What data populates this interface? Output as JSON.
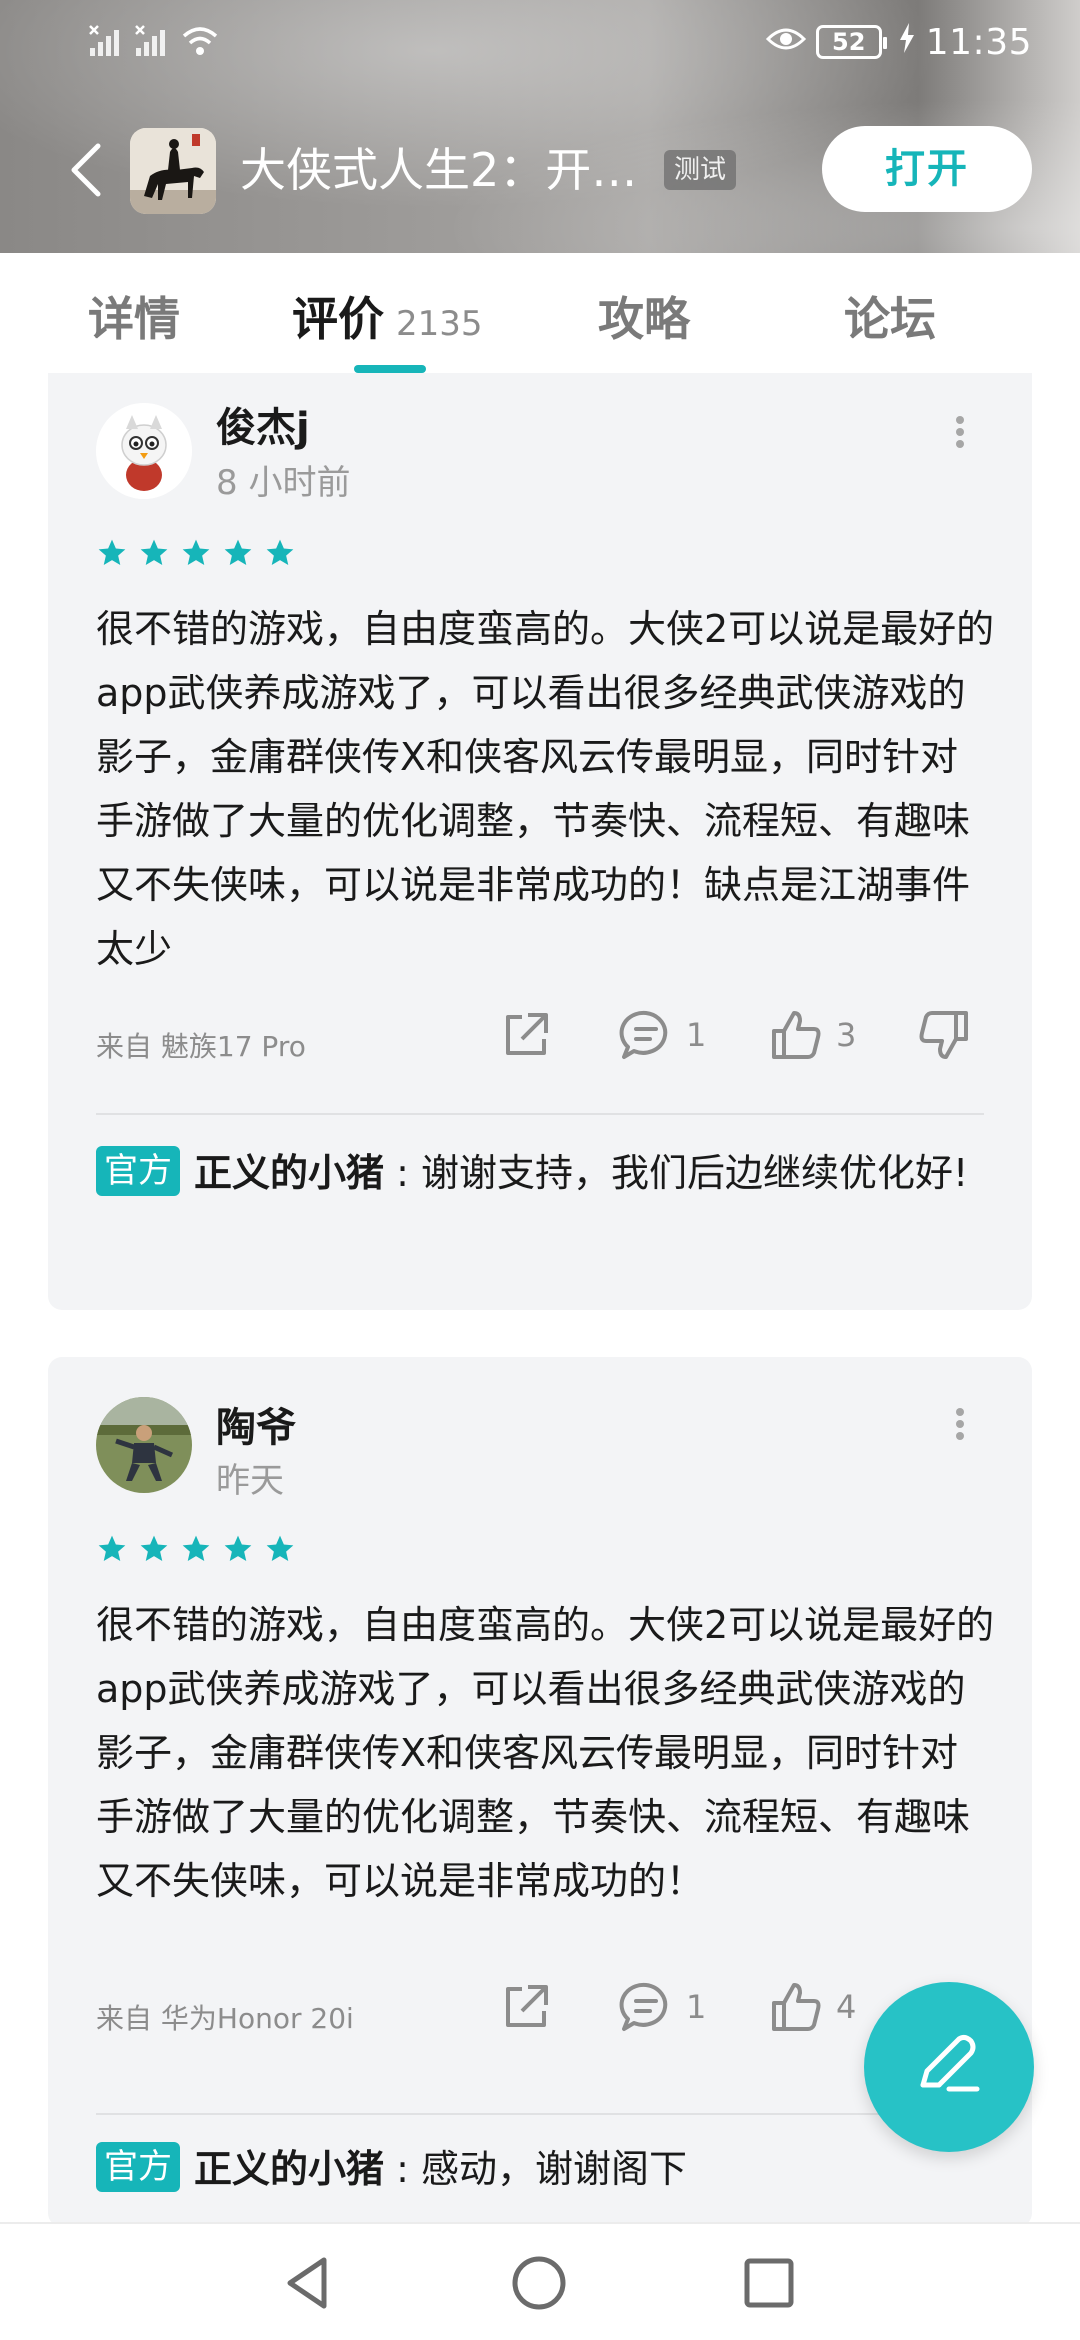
{
  "status_bar": {
    "battery": "52",
    "time": "11:35",
    "icons": [
      "no-sim-icon",
      "no-sim-icon",
      "wifi-icon",
      "eye-icon",
      "battery-icon",
      "charging-icon"
    ]
  },
  "header": {
    "app_title": "大侠式人生2：开…",
    "test_badge": "测试",
    "open_button": "打开"
  },
  "tabs": [
    {
      "label": "详情",
      "count": ""
    },
    {
      "label": "评价",
      "count": "2135"
    },
    {
      "label": "攻略",
      "count": ""
    },
    {
      "label": "论坛",
      "count": ""
    }
  ],
  "active_tab": "评价",
  "reviews": [
    {
      "username": "俊杰j",
      "time": "8 小时前",
      "rating": 5,
      "text": "很不错的游戏，自由度蛮高的。大侠2可以说是最好的app武侠养成游戏了，可以看出很多经典武侠游戏的影子，金庸群侠传X和侠客风云传最明显，同时针对手游做了大量的优化调整，节奏快、流程短、有趣味又不失侠味，可以说是非常成功的！缺点是江湖事件太少",
      "device": "来自 魅族17 Pro",
      "comments": "1",
      "likes": "3",
      "reply_badge": "官方",
      "reply_user": "正义的小猪",
      "reply_text": " : 谢谢支持，我们后边继续优化好!"
    },
    {
      "username": "陶爷",
      "time": "昨天",
      "rating": 5,
      "text": "很不错的游戏，自由度蛮高的。大侠2可以说是最好的app武侠养成游戏了，可以看出很多经典武侠游戏的影子，金庸群侠传X和侠客风云传最明显，同时针对手游做了大量的优化调整，节奏快、流程短、有趣味又不失侠味，可以说是非常成功的！",
      "device": "来自 华为Honor 20i",
      "comments": "1",
      "likes": "4",
      "reply_badge": "官方",
      "reply_user": "正义的小猪",
      "reply_text": " : 感动，谢谢阁下"
    }
  ],
  "colors": {
    "accent": "#16b5b9",
    "fab": "#27c2c6",
    "card_bg": "#f3f4f6",
    "star": "#16b5b9"
  }
}
